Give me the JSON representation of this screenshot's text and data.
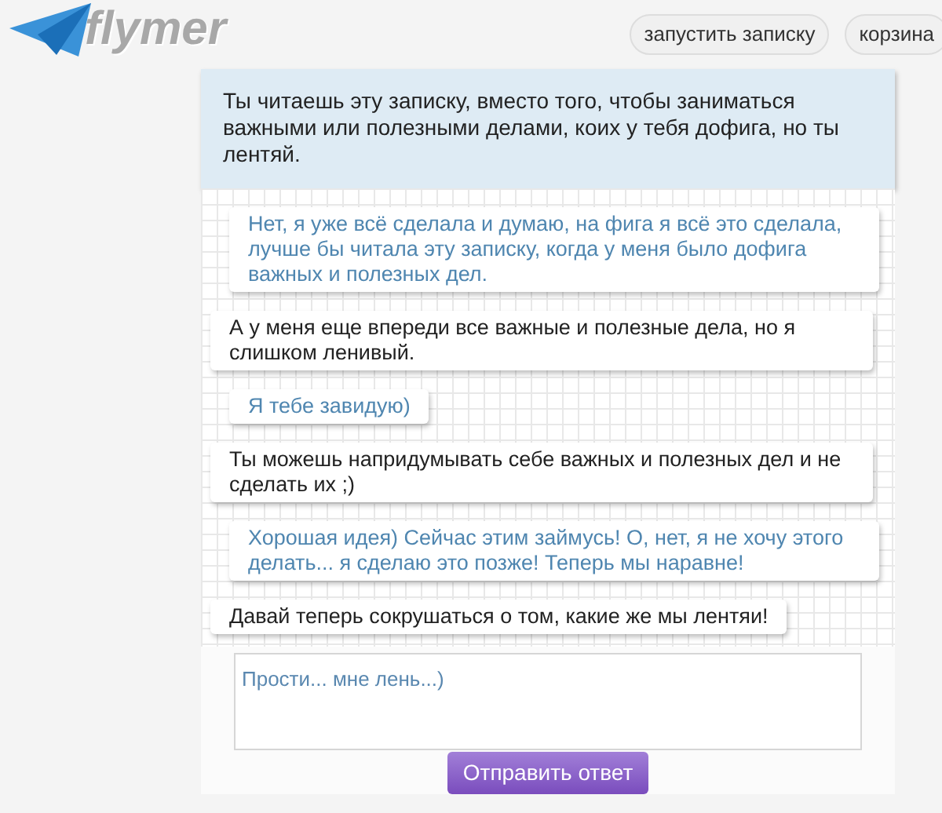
{
  "header": {
    "logo": "flymer",
    "nav": [
      "запустить записку",
      "корзина"
    ]
  },
  "note": "Ты читаешь эту записку, вместо того, чтобы заниматься важными или полезными делами, коих у тебя дофига, но ты лентяй.",
  "messages": [
    {
      "kind": "reply",
      "text": "Нет, я уже всё сделала и думаю, на фига я всё это сделала, лучше бы читала эту записку, когда у меня было дофига важных и полезных дел."
    },
    {
      "kind": "note",
      "text": "А у меня еще впереди все важные и полезные дела, но я слишком ленивый."
    },
    {
      "kind": "reply",
      "text": "Я тебе завидую)"
    },
    {
      "kind": "note",
      "text": "Ты можешь напридумывать себе важных и полезных дел и не сделать их ;)"
    },
    {
      "kind": "reply",
      "text": "Хорошая идея) Сейчас этим займусь! О, нет, я не хочу этого делать... я сделаю это позже! Теперь мы наравне!"
    },
    {
      "kind": "note",
      "text": "Давай теперь сокрушаться о том, какие же мы лентяи!"
    }
  ],
  "reply_box": {
    "value": "Прости... мне лень...)"
  },
  "send_button": "Отправить ответ"
}
